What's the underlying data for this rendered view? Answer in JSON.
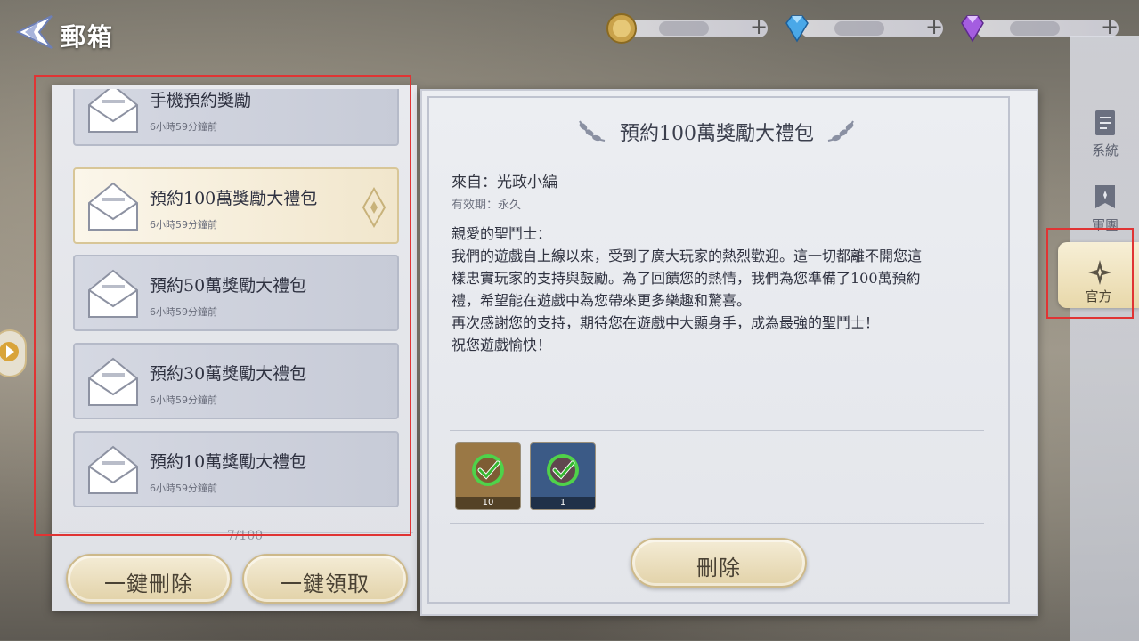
{
  "header": {
    "title": "郵箱"
  },
  "currencies": [
    {
      "name": "gold-coin",
      "value": ""
    },
    {
      "name": "blue-diamond",
      "value": ""
    },
    {
      "name": "purple-diamond",
      "value": ""
    }
  ],
  "mail_list": {
    "items": [
      {
        "title": "手機預約獎勵",
        "time": "6小時59分鐘前",
        "selected": false
      },
      {
        "title": "預約100萬獎勵大禮包",
        "time": "6小時59分鐘前",
        "selected": true
      },
      {
        "title": "預約50萬獎勵大禮包",
        "time": "6小時59分鐘前",
        "selected": false
      },
      {
        "title": "預約30萬獎勵大禮包",
        "time": "6小時59分鐘前",
        "selected": false
      },
      {
        "title": "預約10萬獎勵大禮包",
        "time": "6小時59分鐘前",
        "selected": false
      }
    ],
    "count": "7/100",
    "delete_all_label": "一鍵刪除",
    "claim_all_label": "一鍵領取"
  },
  "detail": {
    "title": "預約100萬獎勵大禮包",
    "from": "來自：光政小編",
    "validity": "有效期：永久",
    "body": [
      "親愛的聖鬥士：",
      "我們的遊戲自上線以來，受到了廣大玩家的熱烈歡迎。這一切都離不開您這",
      "樣忠實玩家的支持與鼓勵。為了回饋您的熱情，我們為您準備了100萬預約",
      "禮，希望能在遊戲中為您帶來更多樂趣和驚喜。",
      "再次感謝您的支持，期待您在遊戲中大顯身手，成為最強的聖鬥士！",
      "祝您遊戲愉快！"
    ],
    "attachments": [
      {
        "qty": "10",
        "claimed": true,
        "color": "#9a7845"
      },
      {
        "qty": "1",
        "claimed": true,
        "color": "#3b5a86"
      }
    ],
    "delete_label": "刪除"
  },
  "tabs": [
    {
      "label": "系統",
      "icon": "document-icon",
      "active": false
    },
    {
      "label": "軍團",
      "icon": "banner-icon",
      "active": false
    },
    {
      "label": "官方",
      "icon": "star-compass-icon",
      "active": true
    }
  ]
}
